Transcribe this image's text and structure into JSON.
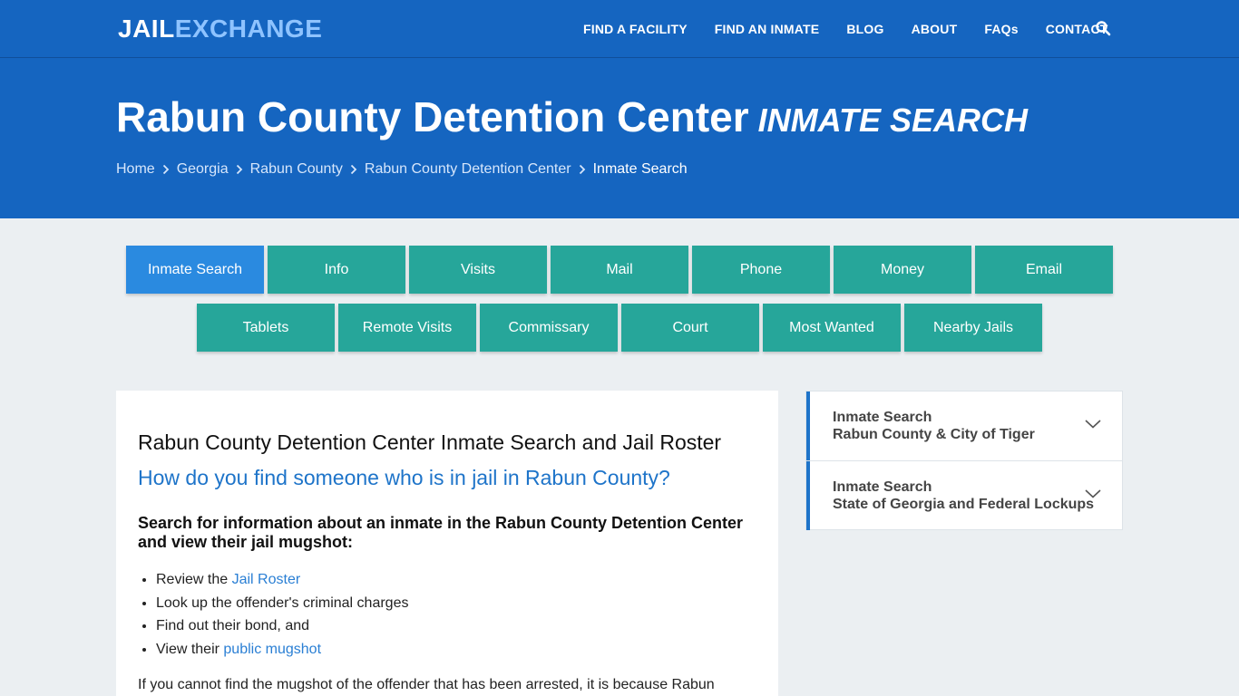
{
  "brand": {
    "logo_part1": "JAIL",
    "logo_part2": "EXCHANGE"
  },
  "nav": {
    "items": [
      "FIND A FACILITY",
      "FIND AN INMATE",
      "BLOG",
      "ABOUT",
      "FAQs",
      "CONTACT"
    ],
    "search_icon": "search-icon"
  },
  "hero": {
    "title": "Rabun County Detention Center",
    "subtitle": "INMATE SEARCH",
    "breadcrumbs": [
      "Home",
      "Georgia",
      "Rabun County",
      "Rabun County Detention Center",
      "Inmate Search"
    ]
  },
  "tabs": {
    "row1": [
      "Inmate Search",
      "Info",
      "Visits",
      "Mail",
      "Phone",
      "Money",
      "Email"
    ],
    "row2": [
      "Tablets",
      "Remote Visits",
      "Commissary",
      "Court",
      "Most Wanted",
      "Nearby Jails"
    ],
    "active": "Inmate Search"
  },
  "main": {
    "heading": "Rabun County Detention Center Inmate Search and Jail Roster",
    "question": "How do you find someone who is in jail in Rabun County?",
    "intro": "Search for information about an inmate in the Rabun County Detention Center and view their jail mugshot:",
    "list": [
      {
        "text": "Review the ",
        "link": "Jail Roster"
      },
      {
        "text": "Look up the offender's criminal charges",
        "link": ""
      },
      {
        "text": "Find out their bond, and",
        "link": ""
      },
      {
        "text": "View their ",
        "link": "public mugshot"
      }
    ],
    "paragraph": "If you cannot find the mugshot of the offender that has been arrested, it is because Rabun"
  },
  "sidebar": {
    "items": [
      {
        "line1": "Inmate Search",
        "line2": "Rabun County & City of Tiger"
      },
      {
        "line1": "Inmate Search",
        "line2": "State of Georgia and Federal Lockups"
      }
    ]
  },
  "colors": {
    "primary_blue": "#1565c0",
    "tab_teal": "#26a69a",
    "tab_active": "#2a8ae0",
    "link_blue": "#2a7fd4",
    "page_bg": "#ebeff2"
  }
}
